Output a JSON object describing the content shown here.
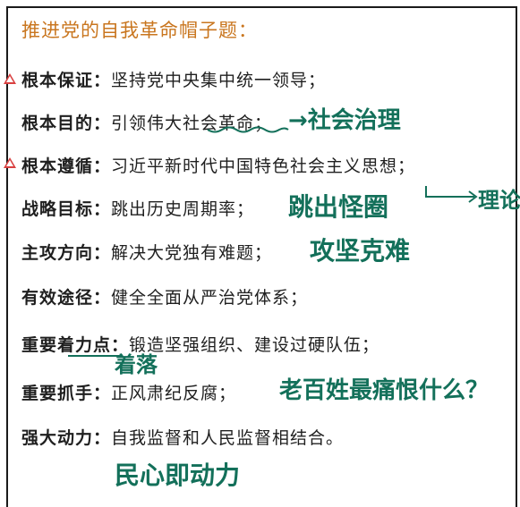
{
  "title": "推进党的自我革命帽子题：",
  "rows": [
    {
      "key": "根本保证：",
      "value": "坚持党中央集中统一领导；"
    },
    {
      "key": "根本目的：",
      "value": "引领伟大社会革命；"
    },
    {
      "key": "根本遵循：",
      "value": "习近平新时代中国特色社会主义思想；"
    },
    {
      "key": "战略目标：",
      "value": "跳出历史周期率；"
    },
    {
      "key": "主攻方向：",
      "value": "解决大党独有难题；"
    },
    {
      "key": "有效途径：",
      "value": "健全全面从严治党体系；"
    },
    {
      "key": "重要着力点：",
      "value": "锻造坚强组织、建设过硬队伍；"
    },
    {
      "key": "重要抓手：",
      "value": "正风肃纪反腐；"
    },
    {
      "key": "强大动力：",
      "value": "自我监督和人民监督相结合。"
    }
  ],
  "notes": {
    "row2": "→社会治理",
    "row3": "理论",
    "row4": "跳出怪圈",
    "row5": "攻坚克难",
    "row7": "着落",
    "row8": "老百姓最痛恨什么？",
    "bottom": "民心即动力"
  },
  "colors": {
    "title": "#c9761f",
    "ink": "#13705a",
    "marker": "#d94040",
    "text": "#1f1f1f"
  },
  "icons": [
    "warning-triangle-icon",
    "warning-triangle-icon"
  ]
}
